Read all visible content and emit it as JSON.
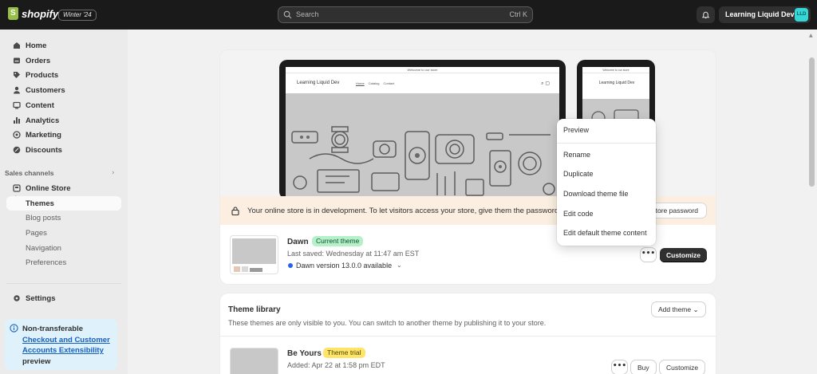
{
  "topbar": {
    "brand": "shopify",
    "edition_badge": "Winter '24",
    "search_placeholder": "Search",
    "search_shortcut": "Ctrl K",
    "account_name": "Learning Liquid Dev",
    "account_initials": "LLD"
  },
  "sidebar": {
    "items": [
      {
        "label": "Home",
        "icon": "home-icon"
      },
      {
        "label": "Orders",
        "icon": "orders-icon"
      },
      {
        "label": "Products",
        "icon": "tag-icon"
      },
      {
        "label": "Customers",
        "icon": "person-icon"
      },
      {
        "label": "Content",
        "icon": "content-icon"
      },
      {
        "label": "Analytics",
        "icon": "bar-chart-icon"
      },
      {
        "label": "Marketing",
        "icon": "target-icon"
      },
      {
        "label": "Discounts",
        "icon": "discount-icon"
      }
    ],
    "sales_channels_label": "Sales channels",
    "online_store": "Online Store",
    "sub_items": [
      "Themes",
      "Blog posts",
      "Pages",
      "Navigation",
      "Preferences"
    ],
    "settings": "Settings",
    "notice": {
      "prefix": "Non-transferable",
      "link": "Checkout and Customer Accounts Extensibility",
      "suffix": "preview"
    }
  },
  "preview": {
    "announcement": "Welcome to our store",
    "store_name": "Learning Liquid Dev",
    "nav_links": [
      "Home",
      "Catalog",
      "Contact"
    ],
    "mobile_store_name": "Learning Liquid Dev"
  },
  "dev_banner": {
    "text": "Your online store is in development. To let visitors access your store, give them the password.",
    "button": "store password"
  },
  "current_theme": {
    "name": "Dawn",
    "badge": "Current theme",
    "last_saved": "Last saved: Wednesday at 11:47 am EST",
    "version_notice": "Dawn version 13.0.0 available",
    "more_label": "•••",
    "customize": "Customize"
  },
  "actions_menu": {
    "items": [
      "Preview",
      "Rename",
      "Duplicate",
      "Download theme file",
      "Edit code",
      "Edit default theme content"
    ]
  },
  "theme_library": {
    "title": "Theme library",
    "add_theme": "Add theme",
    "description": "These themes are only visible to you. You can switch to another theme by publishing it to your store.",
    "themes": [
      {
        "name": "Be Yours",
        "badge": "Theme trial",
        "added": "Added: Apr 22 at 1:58 pm EDT",
        "more_label": "•••",
        "buy": "Buy",
        "customize": "Customize"
      }
    ]
  },
  "colors": {
    "topbar": "#1a1a1a",
    "accent_green": "#b5f0c8",
    "trial_yellow": "#ffe46a",
    "dev_banner": "#fcefe1",
    "notice_bg": "#dff1fb",
    "link_blue": "#1560c0"
  }
}
